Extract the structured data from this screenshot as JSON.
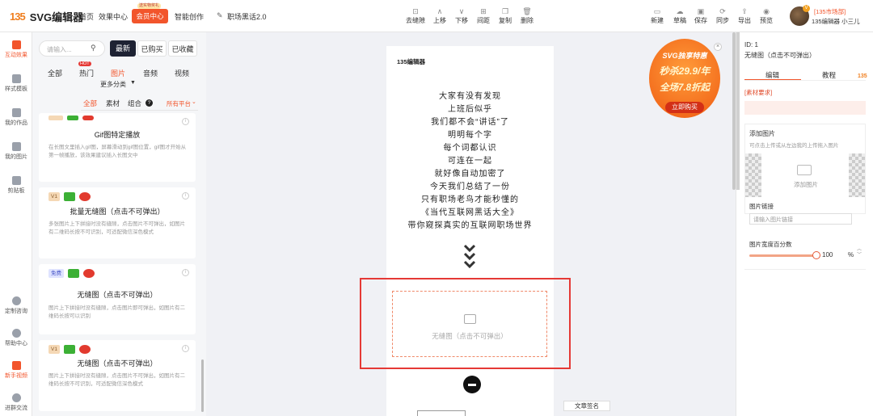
{
  "app": {
    "logo_mark": "135",
    "logo_text": "SVG编辑器"
  },
  "nav": {
    "home": "首页",
    "effects": "效果中心",
    "vip": "会员中心",
    "vip_tag": "送实物奖礼",
    "smart": "智能创作",
    "doc_title": "职场黑话2.0"
  },
  "toolbar": [
    {
      "label": "去缝隙",
      "icon": "seam-icon"
    },
    {
      "label": "上移",
      "icon": "up-icon"
    },
    {
      "label": "下移",
      "icon": "down-icon"
    },
    {
      "label": "间距",
      "icon": "spacing-icon"
    },
    {
      "label": "复制",
      "icon": "copy-icon"
    },
    {
      "label": "删除",
      "icon": "delete-icon"
    }
  ],
  "right_tools": [
    {
      "label": "新建",
      "icon": "new-icon"
    },
    {
      "label": "草稿",
      "icon": "draft-icon"
    },
    {
      "label": "保存",
      "icon": "save-icon"
    },
    {
      "label": "同步",
      "icon": "sync-icon"
    },
    {
      "label": "导出",
      "icon": "export-icon"
    },
    {
      "label": "预览",
      "icon": "preview-icon"
    }
  ],
  "user": {
    "org": "[135市场部]",
    "name": "135编辑器 小三儿",
    "badge": "V"
  },
  "rail": [
    "互动效果",
    "样式模板",
    "我的作品",
    "我的图片",
    "剪贴板",
    "定制咨询",
    "帮助中心",
    "新手视频",
    "进群交流"
  ],
  "panel": {
    "search_placeholder": "请输入...",
    "filters": [
      "最新",
      "已购买",
      "已收藏"
    ],
    "categories": [
      "全部",
      "热门",
      "图片",
      "音频",
      "视频"
    ],
    "hot_tag": "HOT",
    "more": "更多分类",
    "subtabs": [
      "全部",
      "素材",
      "组合"
    ],
    "platform": "所有平台",
    "cards": [
      {
        "title": "Gif图特定播放",
        "desc": "在长图文里插入gif图，屏幕滑动到gif图位置，gif图才开始从第一帧播放，该效果建议插入长图文中",
        "badge": ""
      },
      {
        "title": "批量无缝图（点击不可弹出）",
        "desc": "多张图片上下拼接时没有缝隙，点击图片不可弹出，如图片有二维码长按不可识别，可适配微信深色模式",
        "badge": "V1"
      },
      {
        "title": "无缝图（点击不可弹出）",
        "desc": "图片上下拼接时没有缝隙，点击图片即可弹出，如图片有二维码长按可以识别",
        "badge": "免费"
      },
      {
        "title": "无缝图（点击不可弹出）",
        "desc": "图片上下拼接时没有缝隙，点击图片不可弹出，如图片有二维码长按不可识别，可适配微信深色模式",
        "badge": "V1"
      }
    ]
  },
  "canvas": {
    "page_logo": "135编辑器",
    "poem": [
      "大家有没有发现",
      "上班后似乎",
      "我们都不会“讲话”了",
      "明明每个字",
      "每个词都认识",
      "可连在一起",
      "就好像自动加密了",
      "今天我们总结了一份",
      "只有职场老鸟才能秒懂的",
      "《当代互联网黑话大全》",
      "带你窥探真实的互联网职场世界"
    ],
    "placeholder": "无缝图（点击不可弹出）",
    "signature": "文章签名",
    "promo": {
      "line1": "SVG独享特惠",
      "line2": "秒杀29.9/年",
      "line3": "全场7.8折起",
      "button": "立即购买"
    }
  },
  "rpanel": {
    "id": "ID: 1",
    "name": "无缝图（点击不可弹出）",
    "tabs": [
      "编辑",
      "教程"
    ],
    "req": "[素材要求]",
    "add_title": "添加图片",
    "add_hint": "可点击上传或从左边我的上传拖入图片",
    "add_btn": "添加图片",
    "link_title": "图片链接",
    "link_placeholder": "请输入图片链接",
    "width_title": "图片宽度百分数",
    "width_value": "100",
    "unit": "%"
  },
  "colors": {
    "accent": "#f2552c",
    "frame": "#e53935"
  }
}
